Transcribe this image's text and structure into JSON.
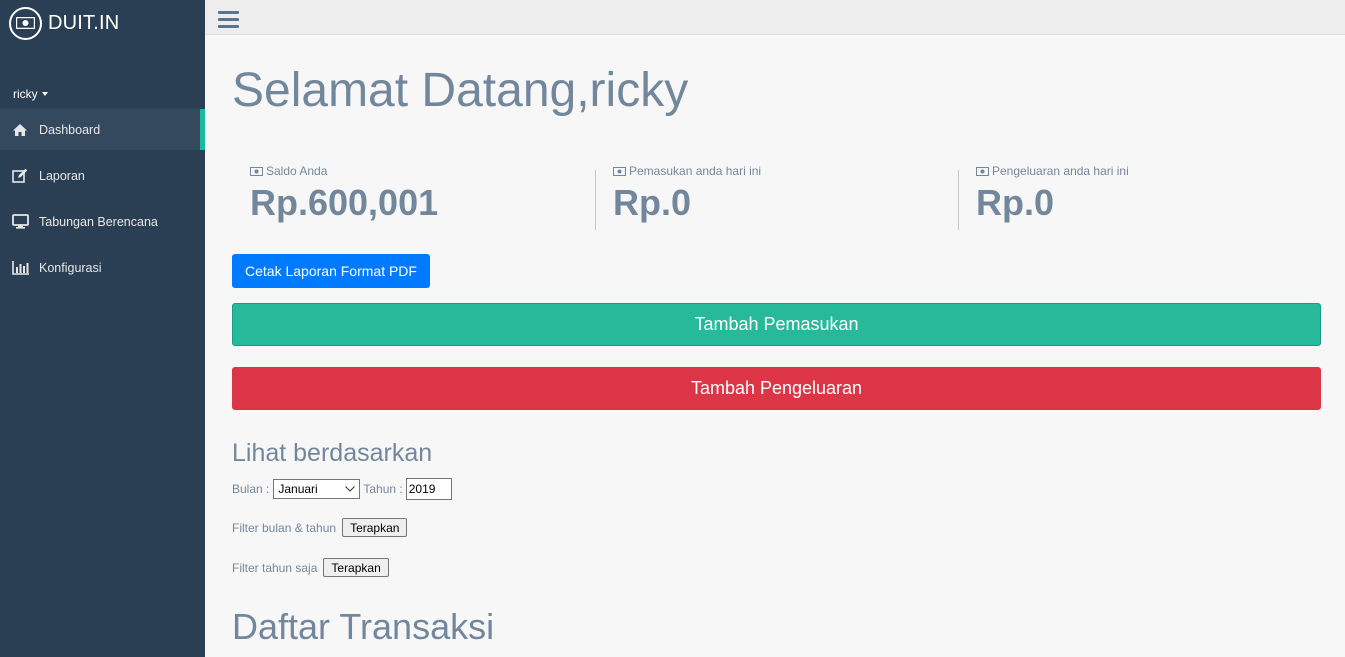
{
  "brand": {
    "name": "DUIT.IN",
    "icon": "money-icon"
  },
  "user": {
    "name": "ricky"
  },
  "sidebar": {
    "items": [
      {
        "label": "Dashboard",
        "icon": "home-icon",
        "active": true
      },
      {
        "label": "Laporan",
        "icon": "edit-icon",
        "active": false
      },
      {
        "label": "Tabungan Berencana",
        "icon": "desktop-icon",
        "active": false
      },
      {
        "label": "Konfigurasi",
        "icon": "bar-chart-icon",
        "active": false
      }
    ]
  },
  "main": {
    "title": "Selamat Datang,ricky",
    "tiles": [
      {
        "label": "Saldo Anda",
        "value": "Rp.600,001"
      },
      {
        "label": "Pemasukan anda hari ini",
        "value": "Rp.0"
      },
      {
        "label": "Pengeluaran anda hari ini",
        "value": "Rp.0"
      }
    ],
    "pdf_button": "Cetak Laporan Format PDF",
    "income_button": "Tambah Pemasukan",
    "expense_button": "Tambah Pengeluaran",
    "filter": {
      "title": "Lihat berdasarkan",
      "month_label": "Bulan :",
      "month_value": "Januari",
      "year_label": "Tahun :",
      "year_value": "2019",
      "filter_month_year_label": "Filter bulan & tahun",
      "filter_year_only_label": "Filter tahun saja",
      "apply_label": "Terapkan"
    },
    "transactions_title": "Daftar Transaksi"
  },
  "colors": {
    "sidebar_bg": "#2a3f54",
    "accent_green": "#26b99a",
    "danger": "#dc3545",
    "primary": "#007bff",
    "text": "#73879c"
  }
}
